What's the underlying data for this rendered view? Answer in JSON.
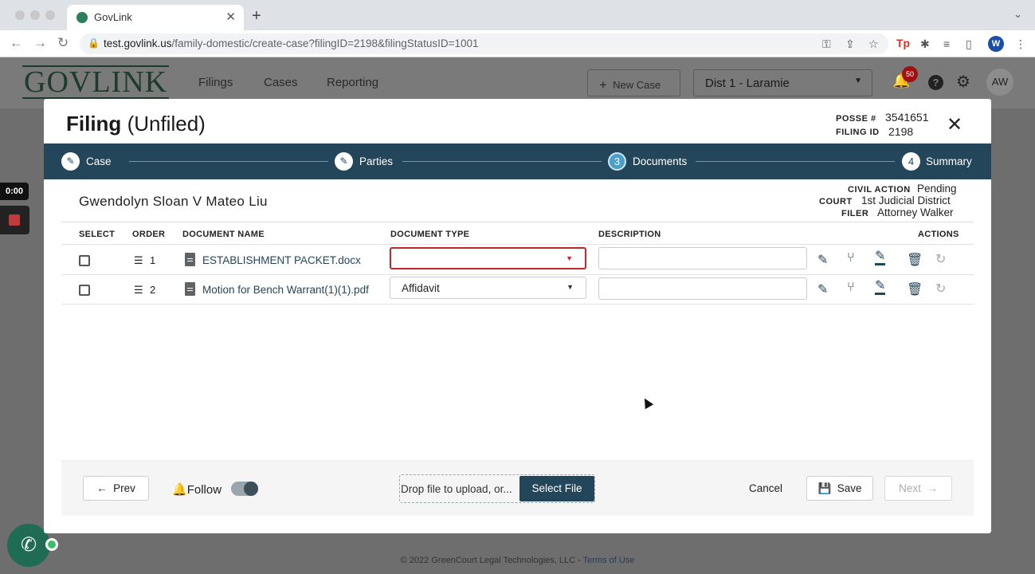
{
  "browser": {
    "tab_title": "GovLink",
    "url_host": "test.govlink.us",
    "url_path": "/family-domestic/create-case?filingID=2198&filingStatusID=1001",
    "profile_initial": "W",
    "ext_tp": "Tp"
  },
  "app": {
    "logo": "GOVLINK",
    "nav": [
      "Filings",
      "Cases",
      "Reporting"
    ],
    "new_case_label": "New Case",
    "district": "Dist 1 - Laramie",
    "notification_count": "50",
    "avatar": "AW"
  },
  "recorder": {
    "time": "0:00"
  },
  "modal": {
    "title_bold": "Filing",
    "title_status": "(Unfiled)",
    "posse_label": "POSSE #",
    "posse_value": "3541651",
    "filing_id_label": "FILING ID",
    "filing_id_value": "2198",
    "steps": [
      {
        "icon": "✎",
        "label": "Case"
      },
      {
        "icon": "✎",
        "label": "Parties"
      },
      {
        "icon": "3",
        "label": "Documents"
      },
      {
        "icon": "4",
        "label": "Summary"
      }
    ],
    "case_name": "Gwendolyn Sloan V Mateo Liu",
    "case_info": {
      "type_label": "CIVIL ACTION",
      "type_value": "Pending",
      "court_label": "COURT",
      "court_value": "1st Judicial District",
      "filer_label": "FILER",
      "filer_value": "Attorney Walker"
    },
    "table": {
      "headers": [
        "SELECT",
        "ORDER",
        "DOCUMENT NAME",
        "DOCUMENT TYPE",
        "DESCRIPTION",
        "ACTIONS"
      ],
      "rows": [
        {
          "order": "1",
          "name": "ESTABLISHMENT PACKET.docx",
          "type": "",
          "description": ""
        },
        {
          "order": "2",
          "name": "Motion for Bench Warrant(1)(1).pdf",
          "type": "Affidavit",
          "description": ""
        }
      ]
    },
    "footer": {
      "prev": "Prev",
      "follow": "Follow",
      "drop_text": "Drop file to upload, or...",
      "select_file": "Select File",
      "cancel": "Cancel",
      "save": "Save",
      "next": "Next"
    }
  },
  "page_footer": {
    "copyright": "© 2022 GreenCourt Legal Technologies, LLC - ",
    "terms": "Terms of Use"
  },
  "colors": {
    "primary": "#24465a",
    "step_active": "#4aa0c8",
    "error": "#c0282d",
    "brand_green": "#1d3a2d"
  }
}
